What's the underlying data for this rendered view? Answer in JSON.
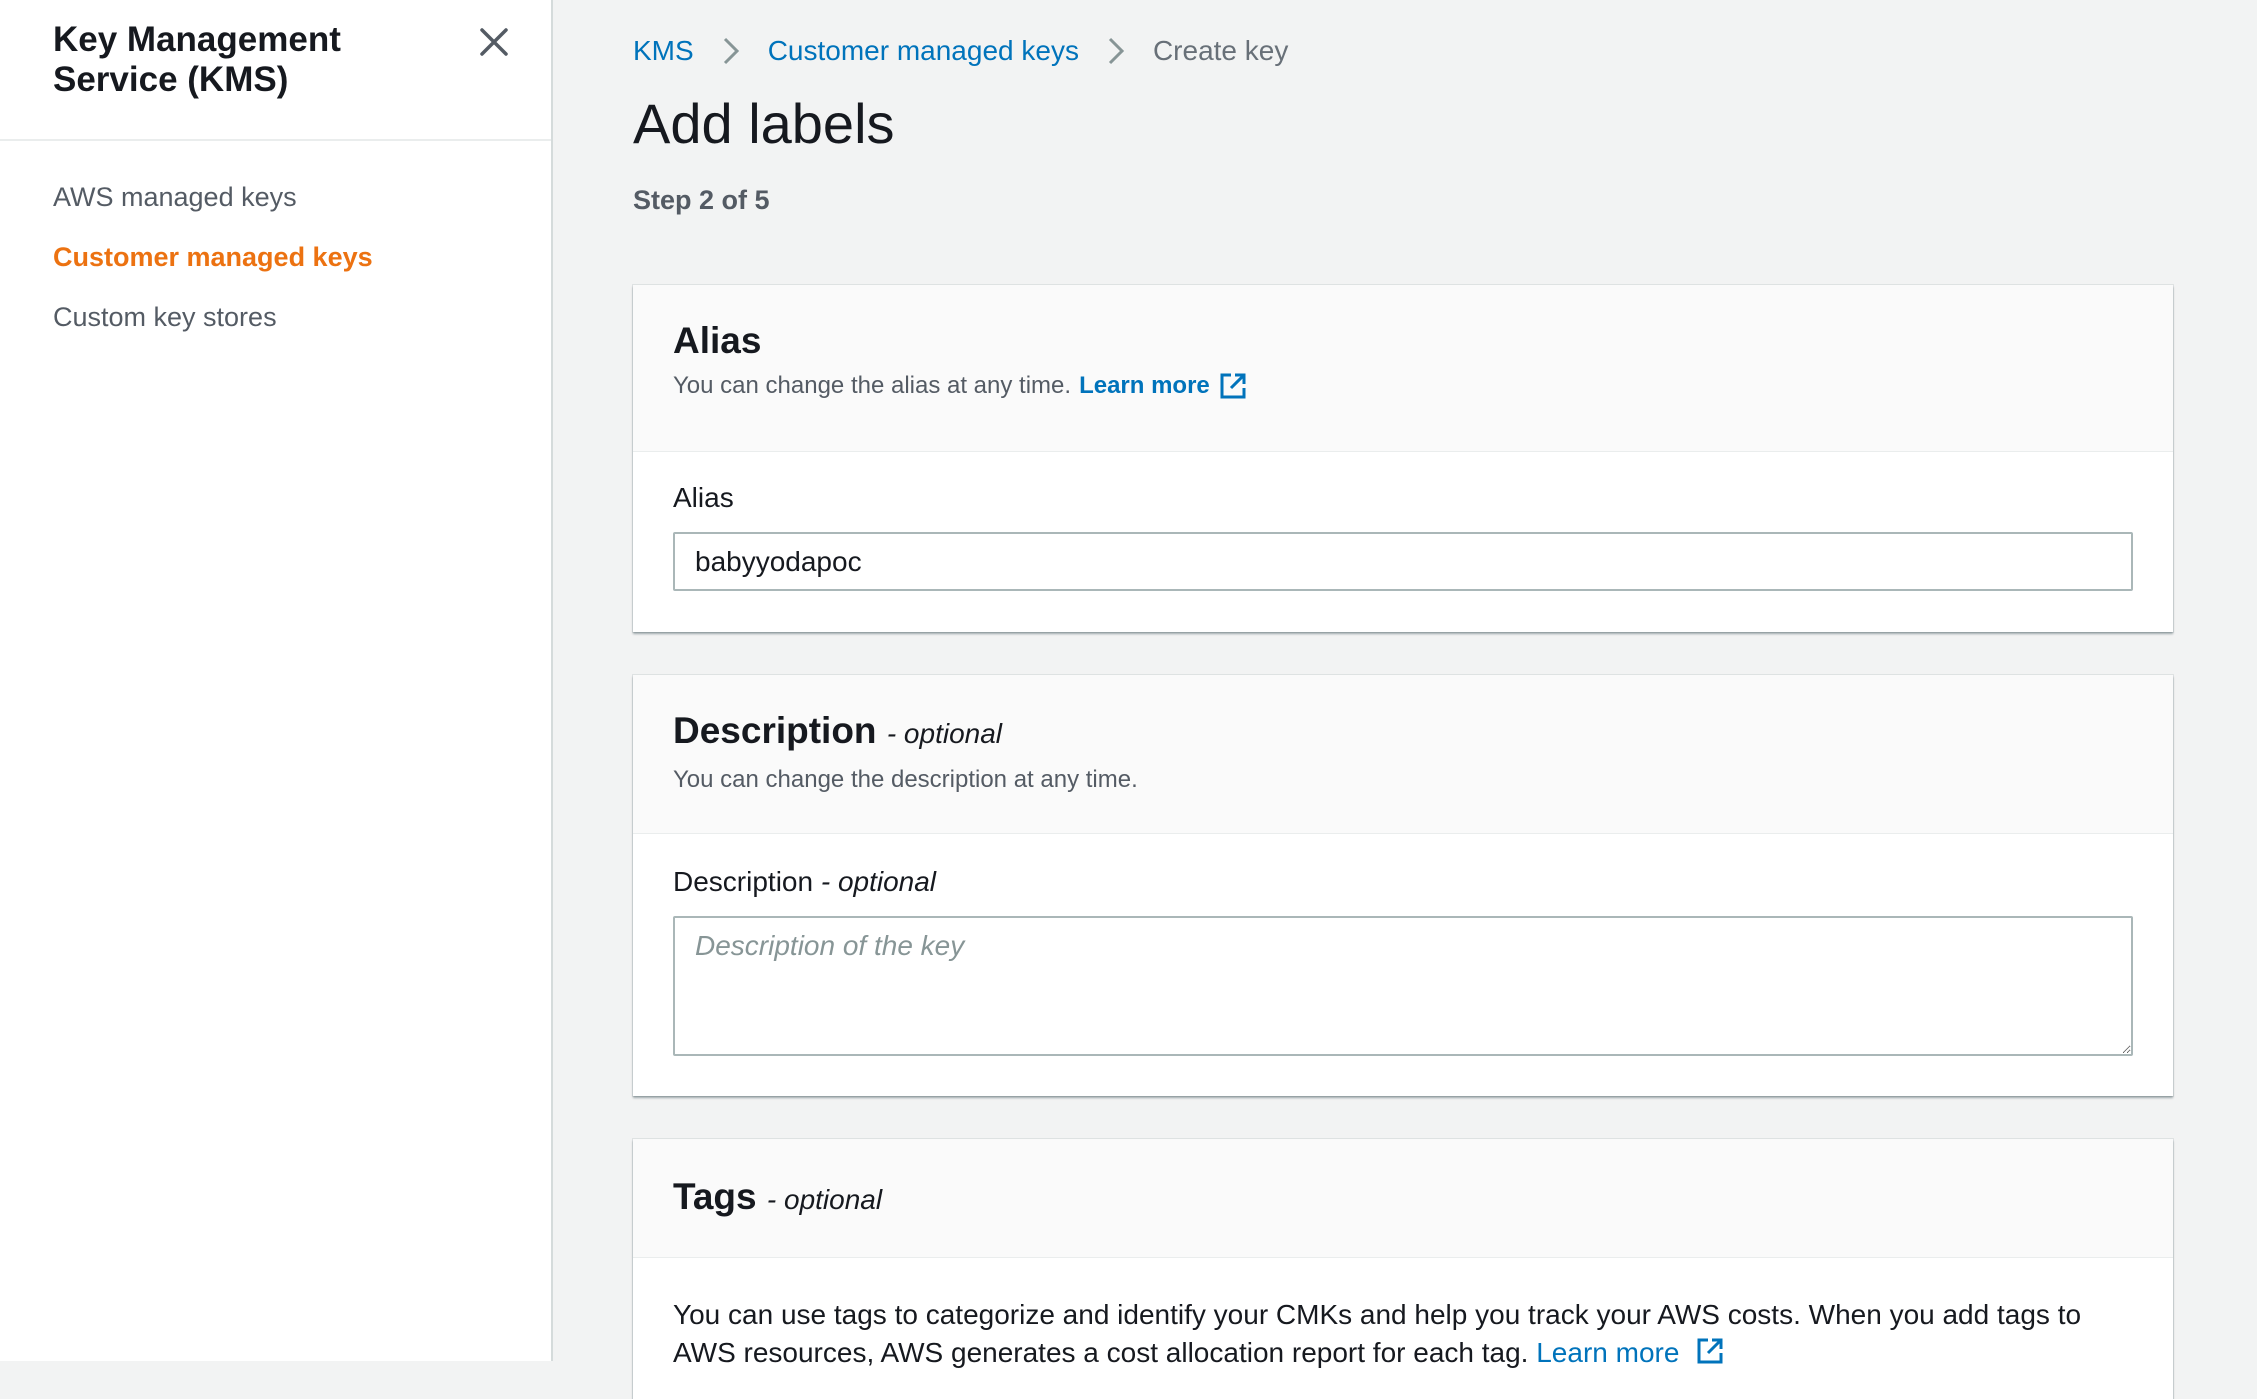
{
  "sidebar": {
    "title": "Key Management Service (KMS)",
    "items": [
      {
        "label": "AWS managed keys",
        "active": false
      },
      {
        "label": "Customer managed keys",
        "active": true
      },
      {
        "label": "Custom key stores",
        "active": false
      }
    ]
  },
  "breadcrumb": {
    "items": [
      "KMS",
      "Customer managed keys",
      "Create key"
    ]
  },
  "page": {
    "title": "Add labels",
    "step": "Step 2 of 5"
  },
  "alias_panel": {
    "title": "Alias",
    "description": "You can change the alias at any time.",
    "learn_more": "Learn more",
    "field_label": "Alias",
    "field_value": "babyyodapoc"
  },
  "description_panel": {
    "title": "Description",
    "optional": "- optional",
    "description": "You can change the description at any time.",
    "field_label": "Description",
    "field_optional": "- optional",
    "placeholder": "Description of the key"
  },
  "tags_panel": {
    "title": "Tags",
    "optional": "- optional",
    "text": "You can use tags to categorize and identify your CMKs and help you track your AWS costs. When you add tags to AWS resources, AWS generates a cost allocation report for each tag.",
    "learn_more": "Learn more"
  },
  "colors": {
    "accent_active": "#ec7211",
    "link": "#0073bb"
  }
}
